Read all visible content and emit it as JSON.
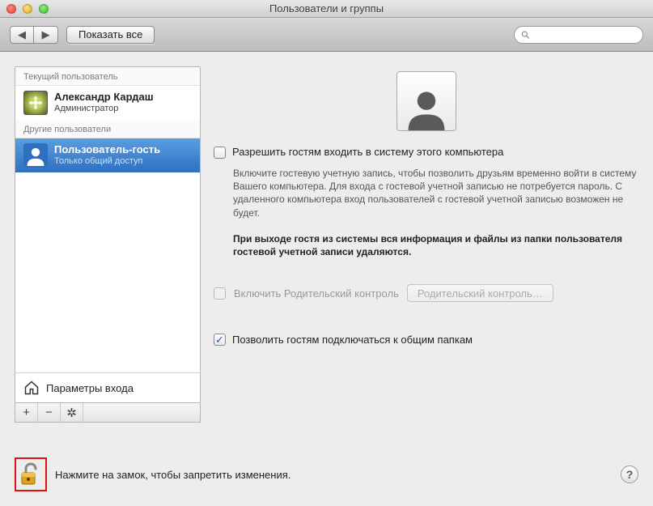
{
  "window": {
    "title": "Пользователи и группы"
  },
  "toolbar": {
    "show_all": "Показать все",
    "search_placeholder": ""
  },
  "sidebar": {
    "current_header": "Текущий пользователь",
    "other_header": "Другие пользователи",
    "current_user": {
      "name": "Александр Кардаш",
      "role": "Администратор"
    },
    "guest_user": {
      "name": "Пользователь-гость",
      "role": "Только общий доступ"
    },
    "login_options": "Параметры входа"
  },
  "detail": {
    "allow_guest_login": "Разрешить гостям входить в систему этого компьютера",
    "allow_guest_desc": "Включите гостевую учетную запись, чтобы позволить друзьям временно войти в систему Вашего компьютера. Для входа с гостевой учетной записью не потребуется пароль. С удаленного компьютера вход пользователей с гостевой учетной записью возможен не будет.",
    "allow_guest_warn": "При выходе гостя из системы вся информация и файлы из папки пользователя гостевой учетной записи удаляются.",
    "enable_parental": "Включить Родительский контроль",
    "open_parental_btn": "Родительский контроль…",
    "allow_shared": "Позволить гостям подключаться к общим папкам"
  },
  "lock": {
    "text": "Нажмите на замок, чтобы запретить изменения."
  },
  "states": {
    "allow_guest_login_checked": false,
    "enable_parental_checked": false,
    "enable_parental_enabled": false,
    "allow_shared_checked": true
  }
}
